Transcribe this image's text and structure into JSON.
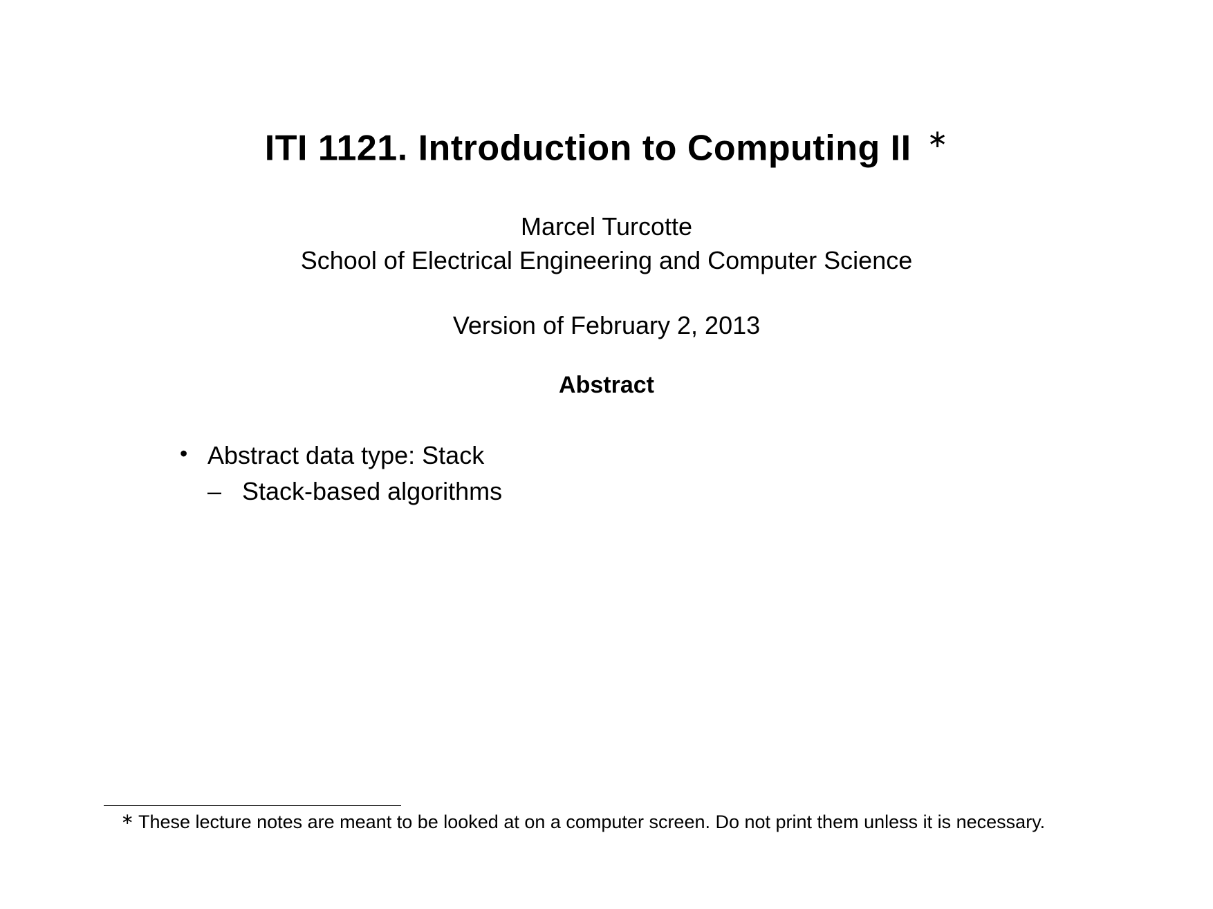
{
  "title": "ITI 1121. Introduction to Computing II",
  "title_footnote_symbol": "∗",
  "author": "Marcel Turcotte",
  "affiliation": "School of Electrical Engineering and Computer Science",
  "version": "Version of February 2, 2013",
  "abstract_heading": "Abstract",
  "bullets": {
    "item1": {
      "text": "Abstract data type: Stack",
      "sub1": "Stack-based algorithms"
    }
  },
  "footnote": {
    "symbol": "∗",
    "text": "These lecture notes are meant to be looked at on a computer screen. Do not print them unless it is necessary."
  }
}
